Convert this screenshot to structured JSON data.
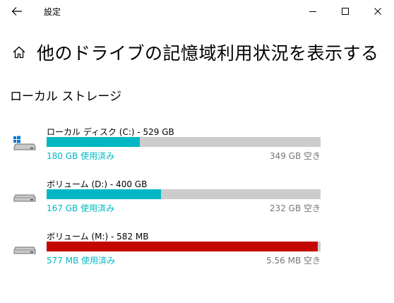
{
  "window": {
    "title": "設定"
  },
  "page": {
    "title": "他のドライブの記憶域利用状況を表示する"
  },
  "section": {
    "title": "ローカル ストレージ"
  },
  "colors": {
    "accent": "#00b7c3",
    "critical": "#c50500",
    "track": "#cccccc",
    "muted": "#767676"
  },
  "drives": [
    {
      "label": "ローカル ディスク (C:) - 529 GB",
      "used": "180 GB 使用済み",
      "free": "349 GB 空き",
      "used_fraction": 0.34,
      "status": "normal",
      "icon": "windows-drive-icon"
    },
    {
      "label": "ボリューム (D:) - 400 GB",
      "used": "167 GB 使用済み",
      "free": "232 GB 空き",
      "used_fraction": 0.4175,
      "status": "normal",
      "icon": "drive-icon"
    },
    {
      "label": "ボリューム (M:) - 582 MB",
      "used": "577 MB 使用済み",
      "free": "5.56 MB 空き",
      "used_fraction": 0.99,
      "status": "critical",
      "icon": "drive-icon"
    }
  ]
}
